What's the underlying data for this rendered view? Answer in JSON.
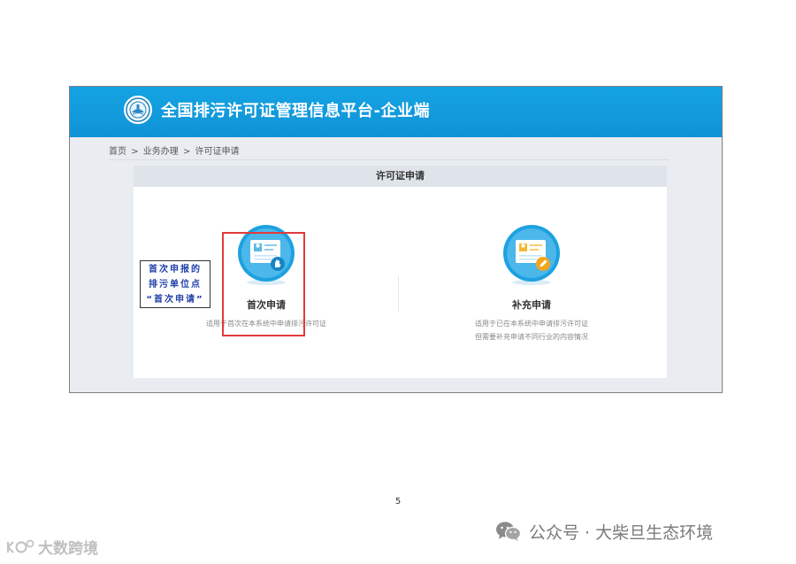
{
  "header": {
    "title": "全国排污许可证管理信息平台-企业端",
    "logo_icon": "emblem-icon",
    "color": "#129cdf"
  },
  "breadcrumb": {
    "items": [
      "首页",
      "业务办理",
      "许可证申请"
    ],
    "separator": ">"
  },
  "panel": {
    "title": "许可证申请",
    "options": [
      {
        "icon": "id-card-hand-icon",
        "label": "首次申请",
        "desc": [
          "适用于首次在本系统中申请排污许可证"
        ]
      },
      {
        "icon": "id-card-pencil-icon",
        "label": "补充申请",
        "desc": [
          "适用于已在本系统中申请排污许可证",
          "但需要补充申请不同行业的内容情况"
        ]
      }
    ]
  },
  "annotation": {
    "lines": [
      "首次申报的",
      "排污单位点",
      "“首次申请”"
    ],
    "highlight_color": "#e23a3a",
    "text_color": "#1f3fa8"
  },
  "page_number": "5",
  "watermarks": {
    "wechat": "公众号 · 大柴旦生态环境",
    "bottom_left": "大数跨境"
  }
}
